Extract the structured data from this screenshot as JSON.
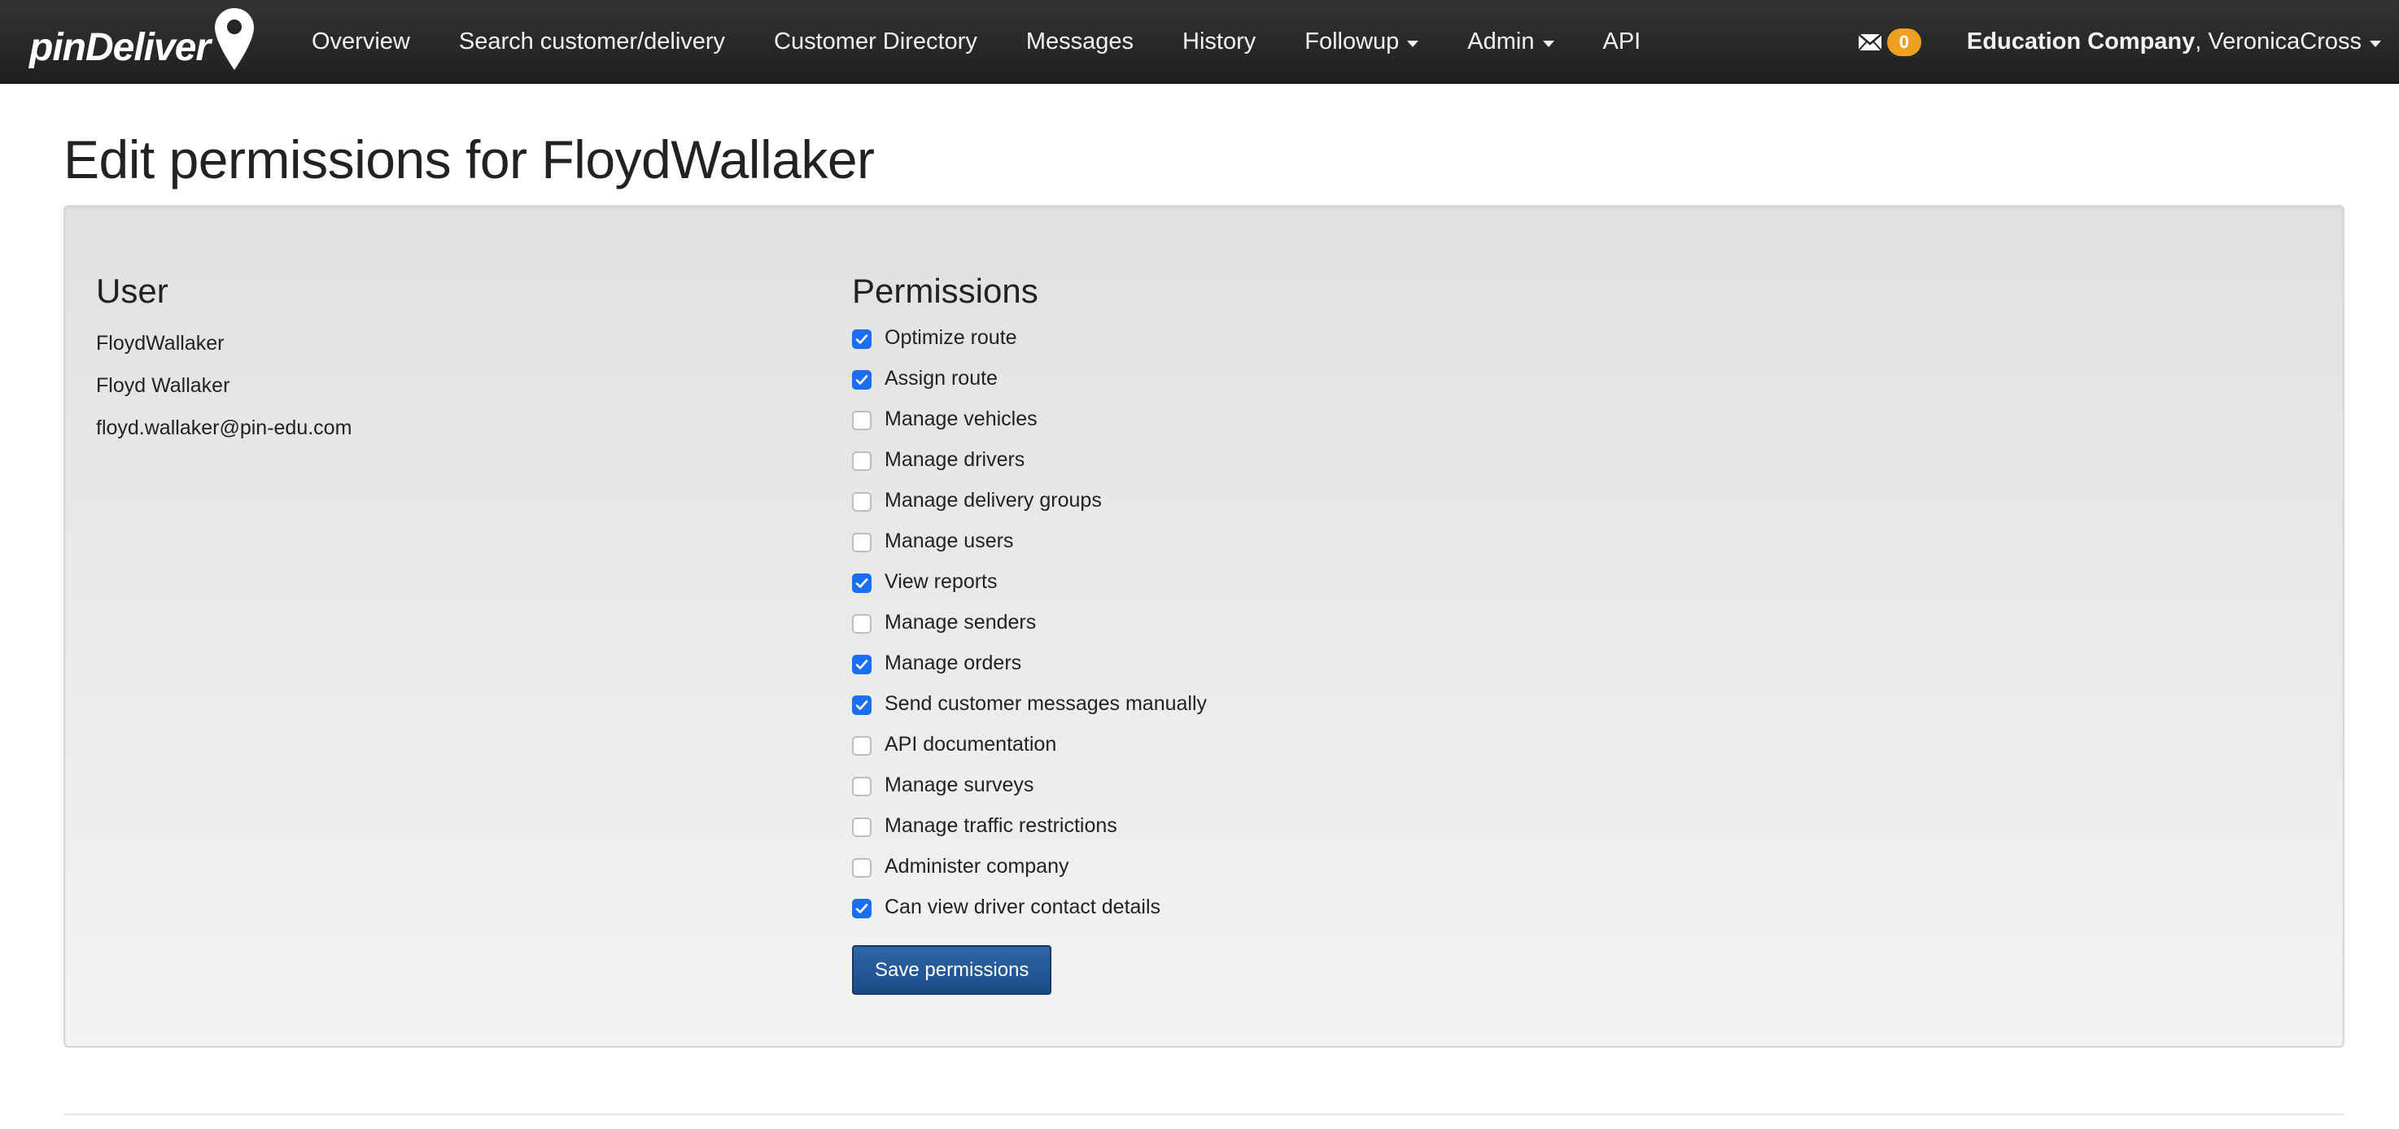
{
  "brand": {
    "name": "pinDeliver"
  },
  "nav": {
    "items": [
      {
        "label": "Overview",
        "dropdown": false,
        "name": "nav-overview"
      },
      {
        "label": "Search customer/delivery",
        "dropdown": false,
        "name": "nav-search"
      },
      {
        "label": "Customer Directory",
        "dropdown": false,
        "name": "nav-customer-directory"
      },
      {
        "label": "Messages",
        "dropdown": false,
        "name": "nav-messages"
      },
      {
        "label": "History",
        "dropdown": false,
        "name": "nav-history"
      },
      {
        "label": "Followup",
        "dropdown": true,
        "name": "nav-followup"
      },
      {
        "label": "Admin",
        "dropdown": true,
        "name": "nav-admin"
      },
      {
        "label": "API",
        "dropdown": false,
        "name": "nav-api"
      }
    ],
    "message_count": "0",
    "user": {
      "company": "Education Company",
      "separator": ", ",
      "username": "VeronicaCross"
    }
  },
  "page": {
    "title": "Edit permissions for FloydWallaker"
  },
  "user_section": {
    "heading": "User",
    "username": "FloydWallaker",
    "full_name": "Floyd Wallaker",
    "email": "floyd.wallaker@pin-edu.com"
  },
  "permissions": {
    "heading": "Permissions",
    "items": [
      {
        "label": "Optimize route",
        "checked": true
      },
      {
        "label": "Assign route",
        "checked": true
      },
      {
        "label": "Manage vehicles",
        "checked": false
      },
      {
        "label": "Manage drivers",
        "checked": false
      },
      {
        "label": "Manage delivery groups",
        "checked": false
      },
      {
        "label": "Manage users",
        "checked": false
      },
      {
        "label": "View reports",
        "checked": true
      },
      {
        "label": "Manage senders",
        "checked": false
      },
      {
        "label": "Manage orders",
        "checked": true
      },
      {
        "label": "Send customer messages manually",
        "checked": true
      },
      {
        "label": "API documentation",
        "checked": false
      },
      {
        "label": "Manage surveys",
        "checked": false
      },
      {
        "label": "Manage traffic restrictions",
        "checked": false
      },
      {
        "label": "Administer company",
        "checked": false
      },
      {
        "label": "Can view driver contact details",
        "checked": true
      }
    ],
    "save_label": "Save permissions"
  },
  "colors": {
    "navbar": "#2a2a2a",
    "badge": "#f0a020",
    "checkbox_on": "#1a6ef0",
    "primary_button": "#1f4f8c"
  }
}
